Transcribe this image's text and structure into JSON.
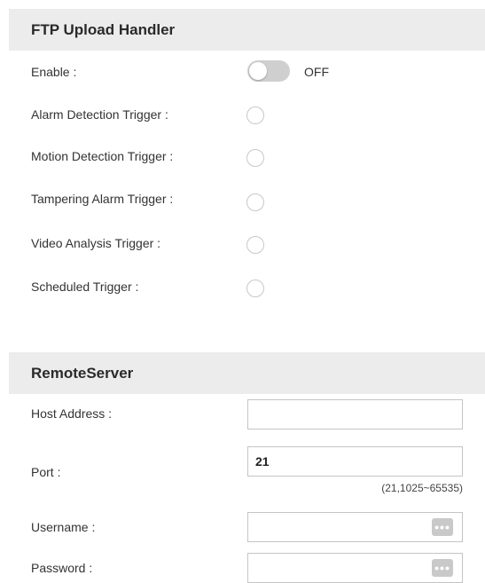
{
  "ftp": {
    "title": "FTP Upload Handler",
    "enable_label": "Enable :",
    "enable_state": "OFF",
    "enable_on": false,
    "triggers": [
      {
        "label": "Alarm Detection Trigger :"
      },
      {
        "label": "Motion Detection Trigger :"
      },
      {
        "label": "Tampering Alarm Trigger :"
      },
      {
        "label": "Video Analysis Trigger :"
      },
      {
        "label": "Scheduled Trigger :"
      }
    ]
  },
  "remote": {
    "title": "RemoteServer",
    "host_label": "Host Address :",
    "host_value": "",
    "port_label": "Port :",
    "port_value": "21",
    "port_hint": "(21,1025~65535)",
    "username_label": "Username :",
    "username_value": "",
    "password_label": "Password :",
    "password_value": "",
    "more_button_glyph": "•••"
  }
}
